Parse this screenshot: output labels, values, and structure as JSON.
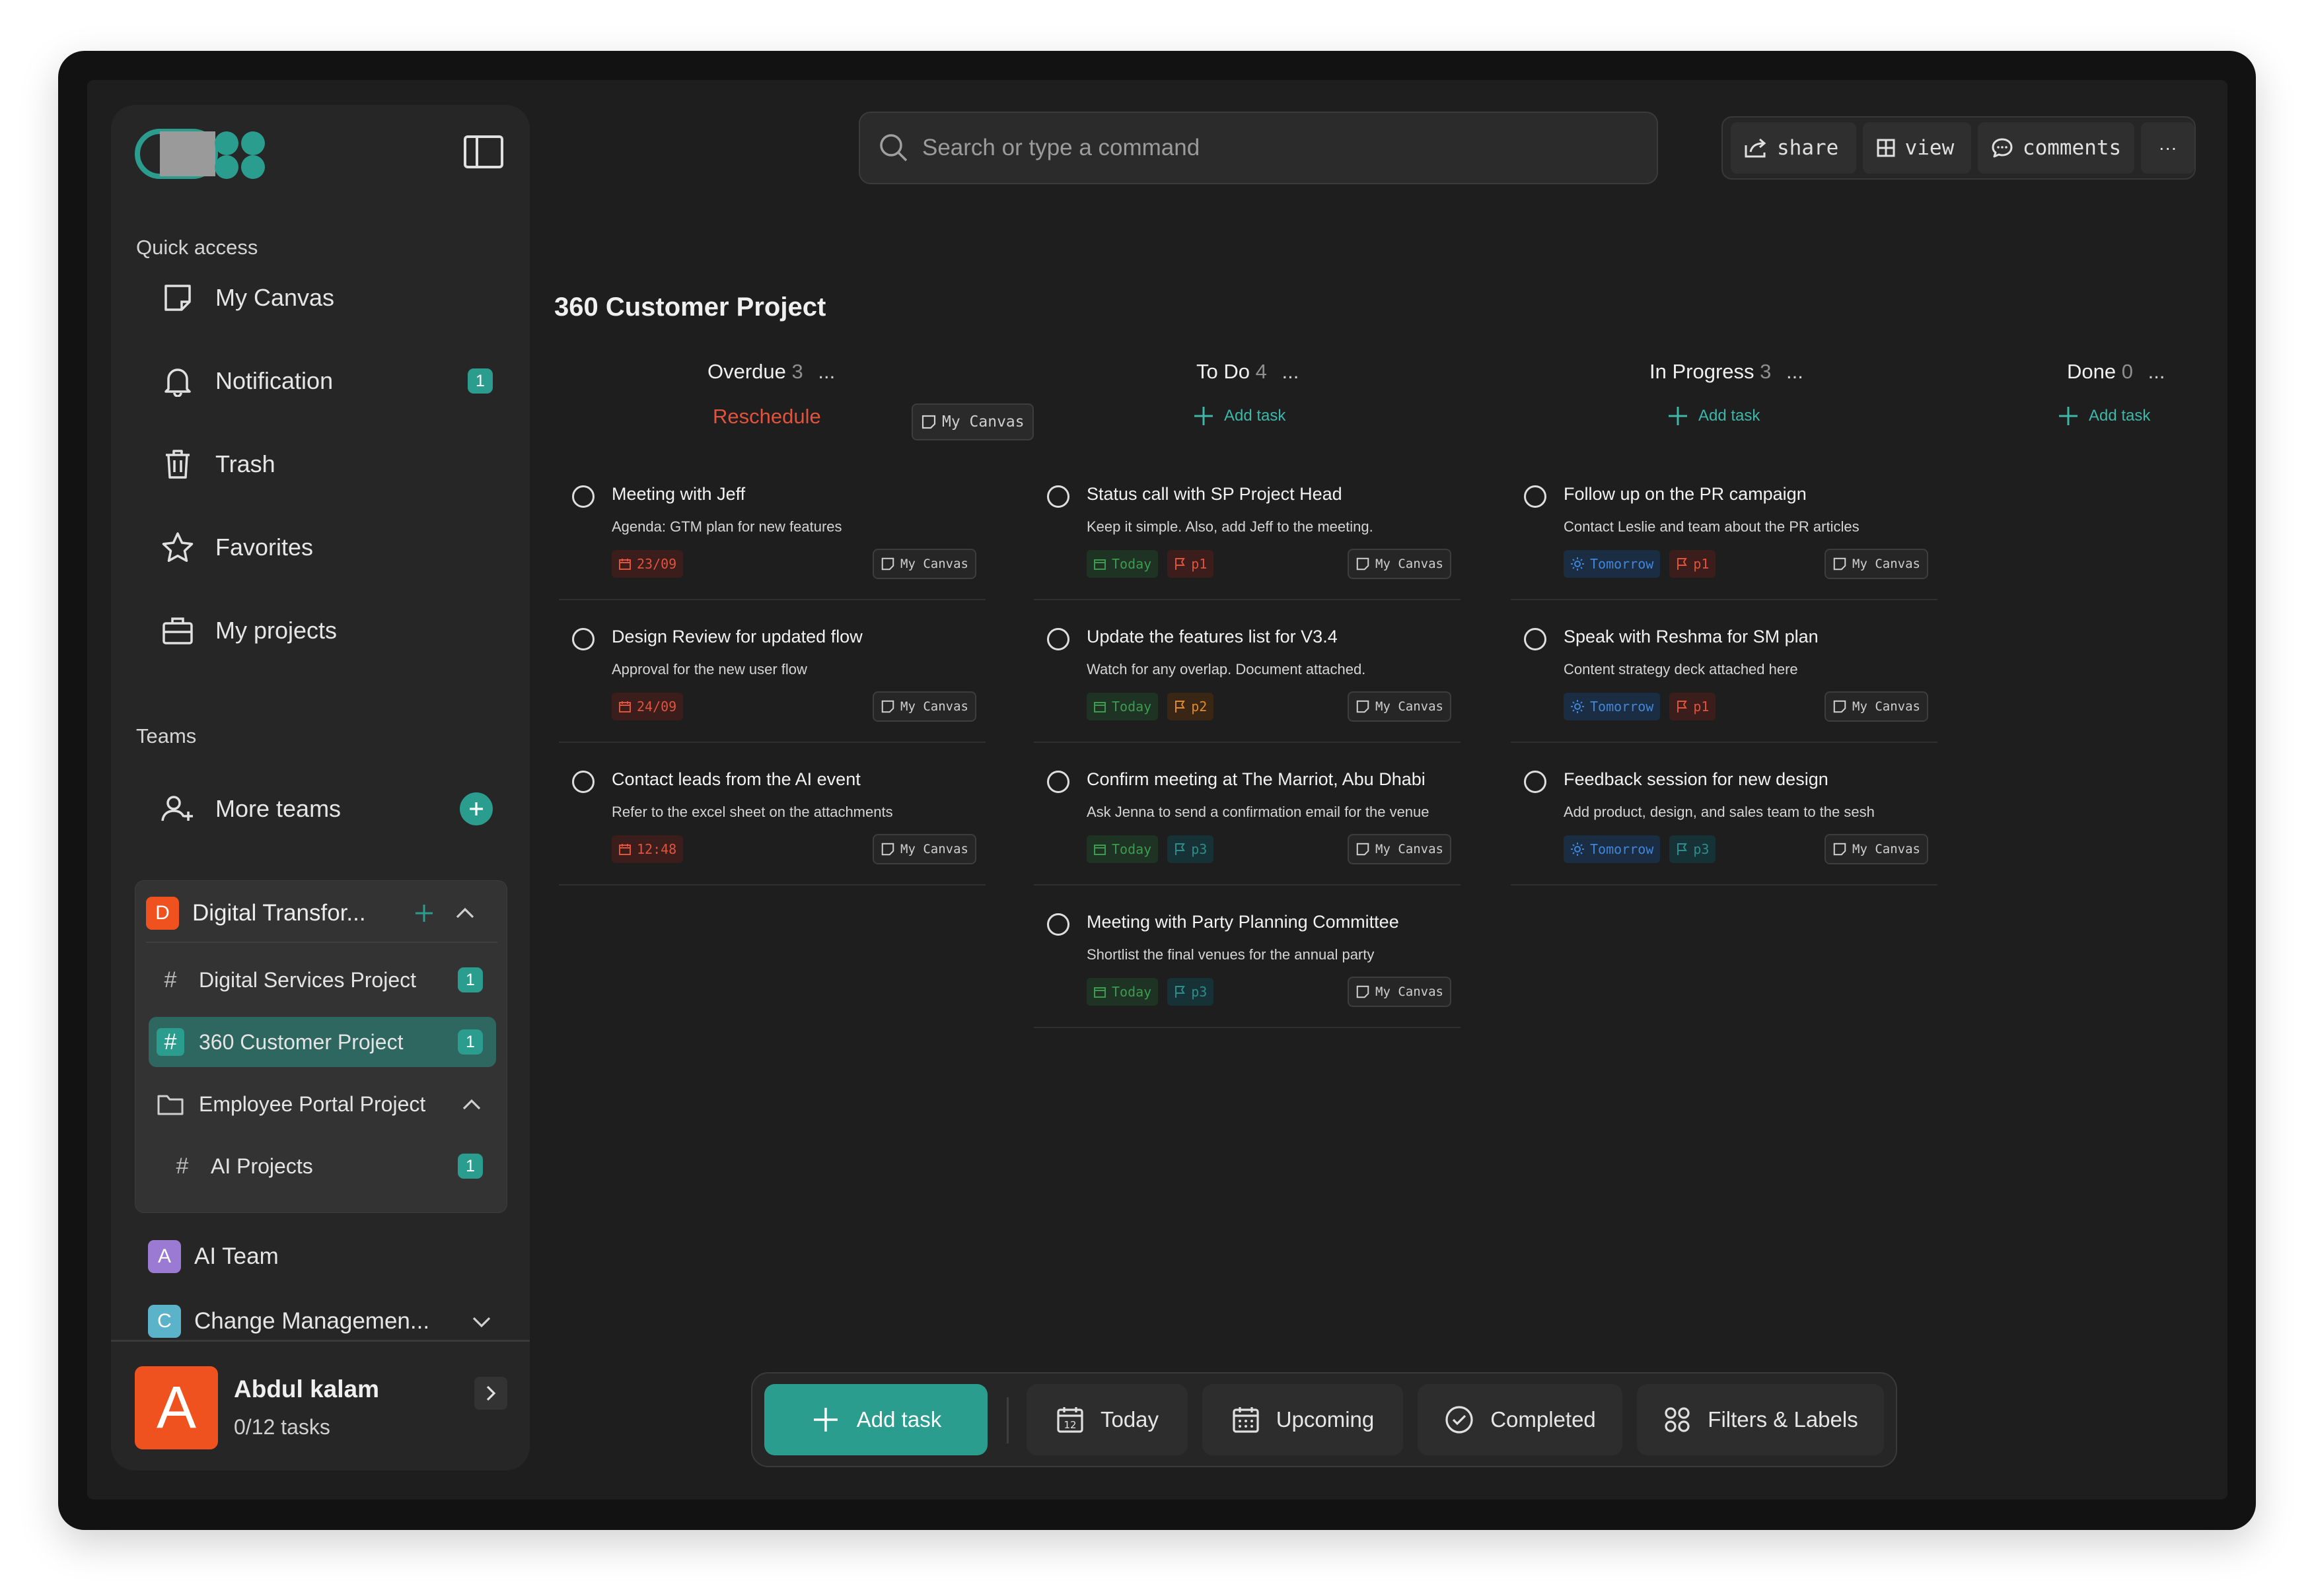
{
  "search": {
    "placeholder": "Search or type a command"
  },
  "toolbar": {
    "share": "share",
    "view": "view",
    "comments": "comments",
    "more": "···"
  },
  "sidebar": {
    "quick_access_label": "Quick access",
    "items": [
      {
        "label": "My Canvas",
        "icon": "canvas-icon"
      },
      {
        "label": "Notification",
        "icon": "bell-icon",
        "badge": "1"
      },
      {
        "label": "Trash",
        "icon": "trash-icon"
      },
      {
        "label": "Favorites",
        "icon": "star-icon"
      },
      {
        "label": "My projects",
        "icon": "briefcase-icon"
      }
    ],
    "teams_label": "Teams",
    "more_teams": "More teams",
    "team_digital": {
      "letter": "D",
      "name": "Digital Transfor..."
    },
    "subitems": [
      {
        "label": "Digital Services Project",
        "badge": "1"
      },
      {
        "label": "360 Customer Project",
        "badge": "1"
      },
      {
        "label": "Employee Portal Project"
      },
      {
        "label": "AI Projects",
        "badge": "1"
      }
    ],
    "team_ai": {
      "letter": "A",
      "name": "AI Team"
    },
    "team_change": {
      "letter": "C",
      "name": "Change Managemen..."
    },
    "user": {
      "initial": "A",
      "name": "Abdul kalam",
      "tasks": "0/12 tasks"
    }
  },
  "board": {
    "title": "360 Customer Project",
    "columns": [
      {
        "name": "Overdue",
        "count": "3",
        "dots": "..."
      },
      {
        "name": "To Do",
        "count": "4",
        "dots": "..."
      },
      {
        "name": "In Progress",
        "count": "3",
        "dots": "..."
      },
      {
        "name": "Done",
        "count": "0",
        "dots": "..."
      }
    ],
    "reschedule": "Reschedule",
    "my_canvas": "My Canvas",
    "add_task": "Add task",
    "cards": [
      {
        "title": "Meeting with Jeff",
        "desc": "Agenda: GTM plan for new features",
        "date": "23/09",
        "canvas": "My Canvas"
      },
      {
        "title": "Design Review for updated flow",
        "desc": "Approval for the new user flow",
        "date": "24/09",
        "canvas": "My Canvas"
      },
      {
        "title": "Contact leads from the AI event",
        "desc": "Refer to the excel sheet on the attachments",
        "date": "12:48",
        "canvas": "My Canvas"
      },
      {
        "title": "Status call with SP Project Head",
        "desc": "Keep it simple. Also, add Jeff to the meeting.",
        "date": "Today",
        "priority": "p1",
        "canvas": "My Canvas"
      },
      {
        "title": "Update the features list for V3.4",
        "desc": "Watch for any overlap. Document attached.",
        "date": "Today",
        "priority": "p2",
        "canvas": "My Canvas"
      },
      {
        "title": "Confirm meeting at The Marriot, Abu Dhabi",
        "desc": "Ask Jenna to send a confirmation email for the venue",
        "date": "Today",
        "priority": "p3",
        "canvas": "My Canvas"
      },
      {
        "title": "Meeting with Party Planning Committee",
        "desc": "Shortlist the final venues for the annual party",
        "date": "Today",
        "priority": "p3",
        "canvas": "My Canvas"
      },
      {
        "title": "Follow up on the PR campaign",
        "desc": "Contact Leslie and team about the PR articles",
        "date": "Tomorrow",
        "priority": "p1",
        "canvas": "My Canvas"
      },
      {
        "title": "Speak with Reshma for SM plan",
        "desc": "Content strategy deck attached here",
        "date": "Tomorrow",
        "priority": "p1",
        "canvas": "My Canvas"
      },
      {
        "title": "Feedback session for new design",
        "desc": "Add product, design, and sales team to the sesh",
        "date": "Tomorrow",
        "priority": "p3",
        "canvas": "My Canvas"
      }
    ]
  },
  "bottom": {
    "add_task": "Add task",
    "today": "Today",
    "upcoming": "Upcoming",
    "completed": "Completed",
    "filters": "Filters & Labels"
  },
  "colors": {
    "accent": "#2a9d8f",
    "overdue": "#e0533d",
    "today": "#3d9a4f",
    "tomorrow": "#3f86d9",
    "p2": "#e08a2d"
  }
}
